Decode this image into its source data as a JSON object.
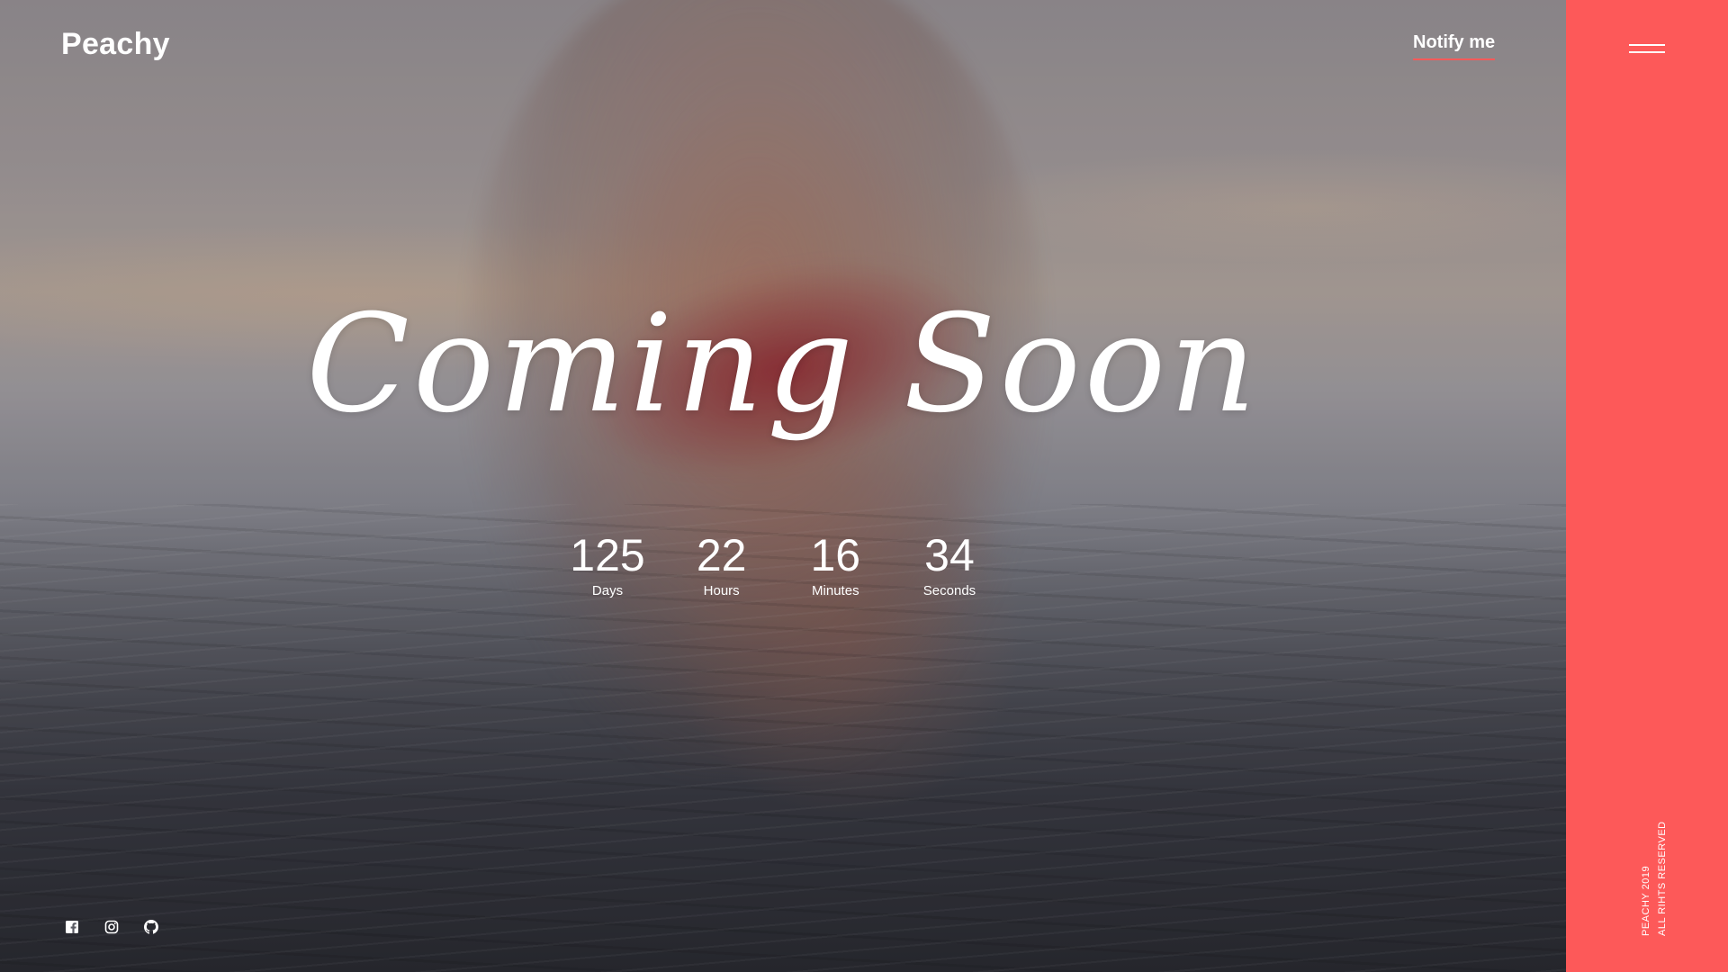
{
  "brand": {
    "name": "Peachy"
  },
  "nav": {
    "notify_label": "Notify me",
    "menu_icon": "hamburger-icon"
  },
  "hero": {
    "headline": "Coming Soon",
    "background": "photo-woman-in-water"
  },
  "countdown": {
    "units": [
      {
        "value": "125",
        "label": "Days"
      },
      {
        "value": "22",
        "label": "Hours"
      },
      {
        "value": "16",
        "label": "Minutes"
      },
      {
        "value": "34",
        "label": "Seconds"
      }
    ]
  },
  "social": {
    "icons": [
      "facebook-icon",
      "instagram-icon",
      "github-icon"
    ]
  },
  "footer": {
    "line1": "PEACHY 2019",
    "line2": "ALL RIHTS RESERVED"
  },
  "colors": {
    "accent": "#fd5959",
    "text": "#ffffff"
  }
}
